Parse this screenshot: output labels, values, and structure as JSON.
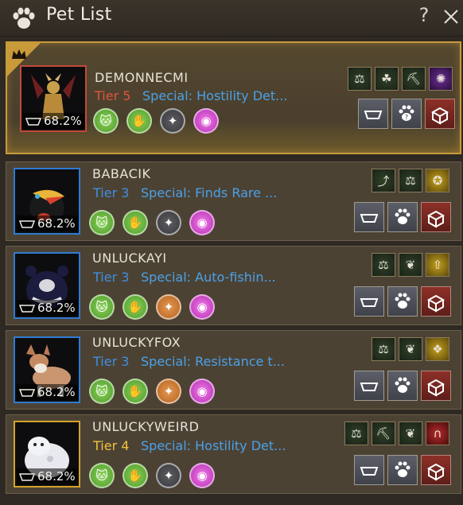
{
  "window": {
    "title": "Pet List",
    "help_label": "?"
  },
  "colors": {
    "tier5": "#e0533f",
    "tier3": "#3f8fe0",
    "tier4": "#f2c23a"
  },
  "pets": [
    {
      "name": "DEMONNECMI",
      "tier": "Tier 5",
      "special": "Special: Hostility Det...",
      "hunger": "68.2%"
    },
    {
      "name": "BABACIK",
      "tier": "Tier 3",
      "special": "Special: Finds Rare ...",
      "hunger": "68.2%"
    },
    {
      "name": "UNLUCKAYI",
      "tier": "Tier 3",
      "special": "Special: Auto-fishin...",
      "hunger": "68.2%"
    },
    {
      "name": "UNLUCKYFOX",
      "tier": "Tier 3",
      "special": "Special: Resistance t...",
      "hunger": "68.2%"
    },
    {
      "name": "UNLUCKYWEIRD",
      "tier": "Tier 4",
      "special": "Special: Hostility Det...",
      "hunger": "68.2%"
    }
  ]
}
